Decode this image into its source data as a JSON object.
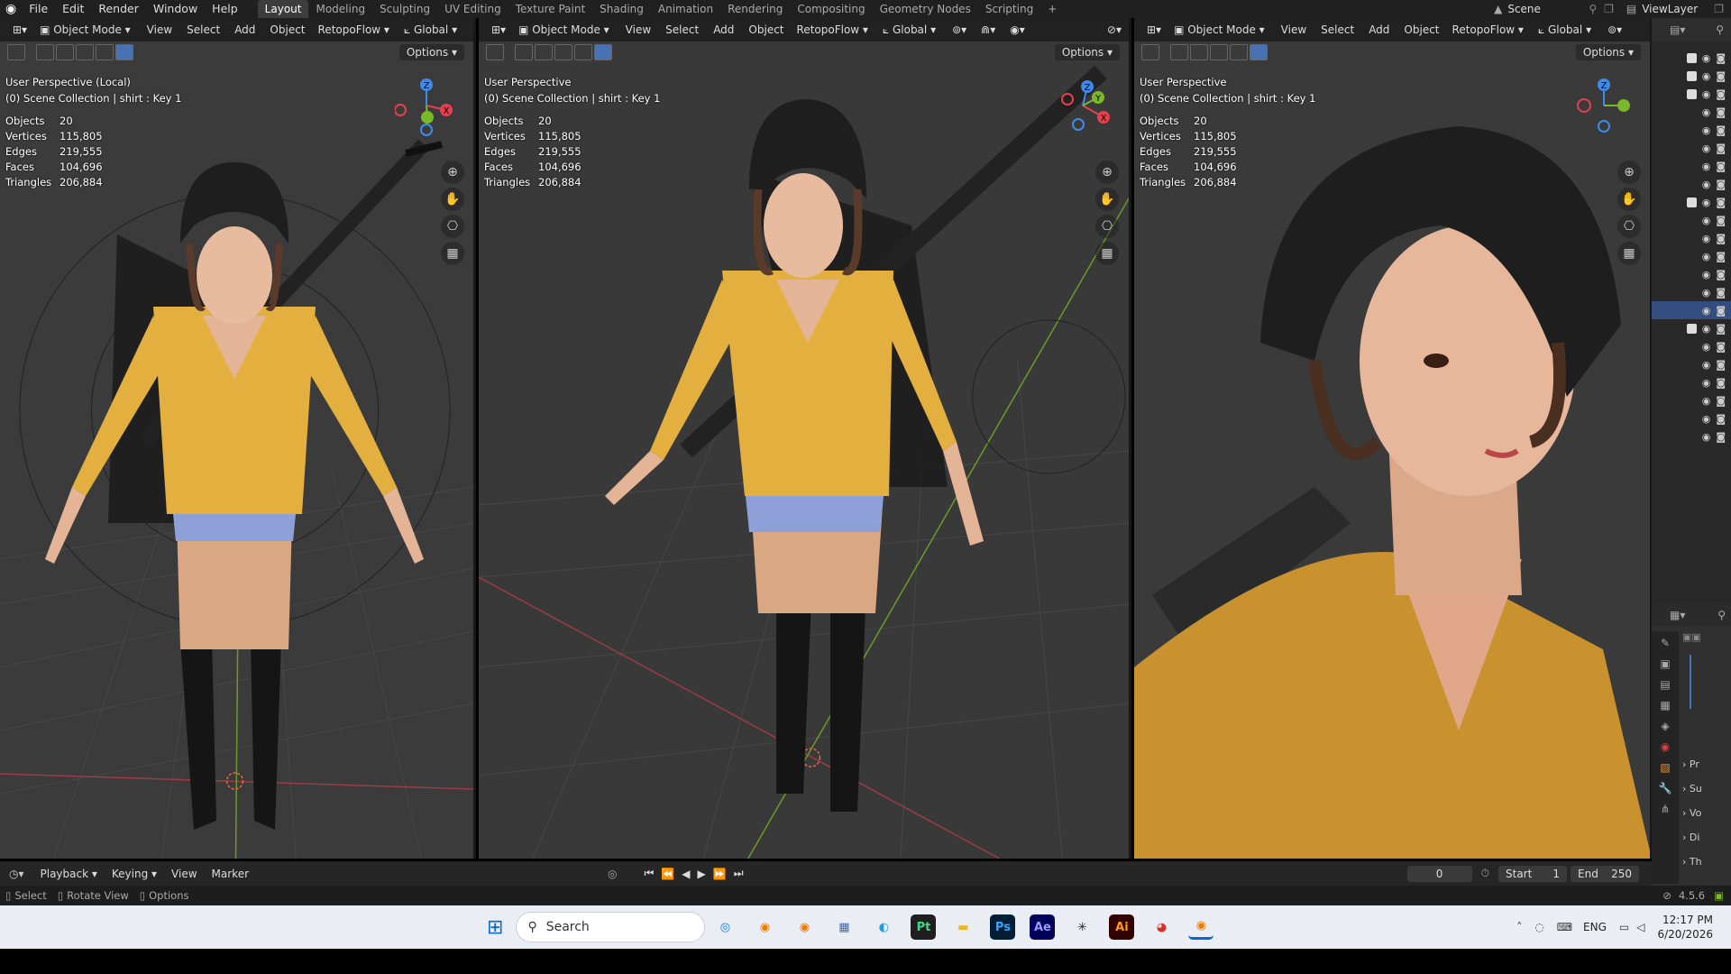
{
  "topbar": {
    "menus": [
      "File",
      "Edit",
      "Render",
      "Window",
      "Help"
    ],
    "workspaces": [
      "Layout",
      "Modeling",
      "Sculpting",
      "UV Editing",
      "Texture Paint",
      "Shading",
      "Animation",
      "Rendering",
      "Compositing",
      "Geometry Nodes",
      "Scripting"
    ],
    "active_workspace": "Layout",
    "scene": "Scene",
    "view_layer": "ViewLayer",
    "add_tab": "+"
  },
  "viewport_header": {
    "mode": "Object Mode",
    "menus": [
      "View",
      "Select",
      "Add",
      "Object"
    ],
    "addon": "RetopoFlow",
    "transform": "Global",
    "options": "Options"
  },
  "viewports": [
    {
      "title": "User Perspective (Local)",
      "collection": "(0) Scene Collection | shirt : Key 1"
    },
    {
      "title": "User Perspective",
      "collection": "(0) Scene Collection | shirt : Key 1"
    },
    {
      "title": "User Perspective",
      "collection": "(0) Scene Collection | shirt : Key 1"
    }
  ],
  "stats": {
    "labels": [
      "Objects",
      "Vertices",
      "Edges",
      "Faces",
      "Triangles"
    ],
    "values": [
      "20",
      "115,805",
      "219,555",
      "104,696",
      "206,884"
    ]
  },
  "gizmo": {
    "x": "X",
    "y": "Y",
    "z": "Z"
  },
  "properties": {
    "panels": [
      "Pr",
      "Su",
      "Vo",
      "Di",
      "Th"
    ]
  },
  "timeline": {
    "menus": [
      "Playback",
      "Keying",
      "View",
      "Marker"
    ],
    "current_frame": "0",
    "start_label": "Start",
    "start": "1",
    "end_label": "End",
    "end": "250"
  },
  "statusbar": {
    "items": [
      "Select",
      "Rotate View",
      "Options"
    ],
    "version": "4.5.6"
  },
  "taskbar": {
    "search": "Search",
    "language": "ENG",
    "time": "12:17 PM",
    "date": "6/20/2026",
    "apps": [
      {
        "name": "Pt",
        "color": "#1f1f1f",
        "fg": "#3ddc84"
      },
      {
        "name": "Ps",
        "color": "#001e36",
        "fg": "#31a8ff"
      },
      {
        "name": "Ae",
        "color": "#00005b",
        "fg": "#9999ff"
      },
      {
        "name": "Ai",
        "color": "#330000",
        "fg": "#ff9a00"
      }
    ]
  },
  "colors": {
    "accent": "#4772b3",
    "axis_x": "#e4404f",
    "axis_y": "#7ab82a",
    "axis_z": "#3f8be8",
    "sweater": "#e3b040",
    "helmet": "#1e1e1e"
  }
}
